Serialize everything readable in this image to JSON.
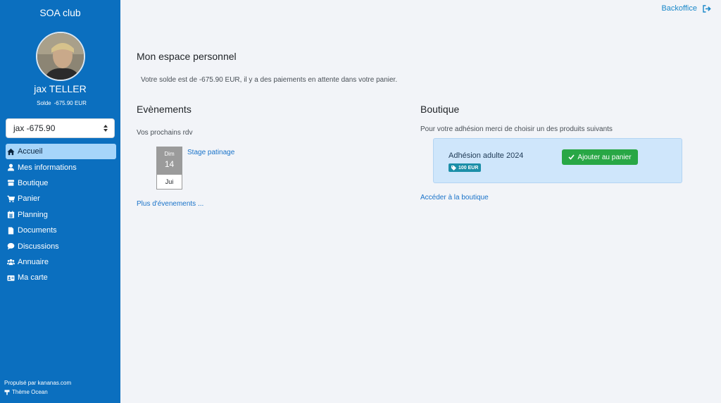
{
  "sidebar": {
    "club_name": "SOA club",
    "user_name": "jax TELLER",
    "solde_label": "Solde",
    "solde_value": "-675.90 EUR",
    "account_select_value": "jax -675.90",
    "items": [
      {
        "label": "Accueil",
        "icon": "home-icon",
        "active": true
      },
      {
        "label": "Mes informations",
        "icon": "user-icon"
      },
      {
        "label": "Boutique",
        "icon": "store-icon"
      },
      {
        "label": "Panier",
        "icon": "cart-icon"
      },
      {
        "label": "Planning",
        "icon": "calendar-icon"
      },
      {
        "label": "Documents",
        "icon": "file-icon"
      },
      {
        "label": "Discussions",
        "icon": "comment-icon"
      },
      {
        "label": "Annuaire",
        "icon": "users-icon"
      },
      {
        "label": "Ma carte",
        "icon": "id-card-icon"
      }
    ],
    "footer_powered": "Propulsé par kananas.com",
    "footer_theme": "Thème Ocean"
  },
  "header": {
    "backoffice_label": "Backoffice"
  },
  "main": {
    "title": "Mon espace personnel",
    "balance_message": "Votre solde est de -675.90 EUR, il y a des paiements en attente dans votre panier.",
    "events": {
      "title": "Evènements",
      "subtitle": "Vos prochains rdv",
      "event": {
        "day_name": "Dim",
        "day_number": "14",
        "month": "Jui",
        "label": "Stage patinage"
      },
      "more_label": "Plus d'évenements ..."
    },
    "shop": {
      "title": "Boutique",
      "subtitle": "Pour votre adhésion merci de choisir un des produits suivants",
      "product_name": "Adhésion adulte 2024",
      "product_price": "100 EUR",
      "add_button_label": "Ajouter au panier",
      "shop_link_label": "Accéder à la boutique"
    }
  },
  "colors": {
    "sidebar_bg": "#0b6fbf",
    "active_item_bg": "#a6d5fa",
    "link": "#1a73c9",
    "success": "#28a745",
    "badge": "#1c8fa8"
  }
}
